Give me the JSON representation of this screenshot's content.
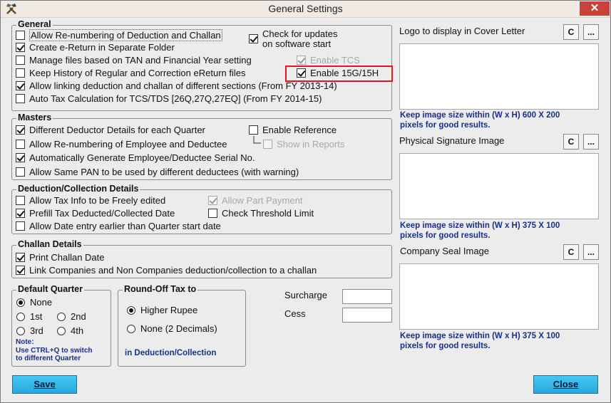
{
  "window": {
    "title": "General Settings",
    "close_glyph": "✕",
    "app_icon": "hammer-pick-icon"
  },
  "general": {
    "title": "General",
    "items": [
      {
        "label": "Allow Re-numbering of Deduction and Challan",
        "checked": false
      },
      {
        "label": "Create e-Return in Separate Folder",
        "checked": true
      },
      {
        "label": "Manage files based on TAN and Financial Year setting",
        "checked": false
      },
      {
        "label": "Keep History of Regular and Correction eReturn files",
        "checked": false
      },
      {
        "label": "Allow linking deduction and challan of different sections (From FY 2013-14)",
        "checked": true
      },
      {
        "label": "Auto Tax Calculation for TCS/TDS [26Q,27Q,27EQ] (From FY 2014-15)",
        "checked": false
      }
    ],
    "check_updates_line1": "Check for updates",
    "check_updates_line2": "on software start",
    "enable_tcs": "Enable TCS",
    "enable_15g": "Enable 15G/15H"
  },
  "masters": {
    "title": "Masters",
    "items": [
      {
        "label": "Different Deductor Details for each Quarter",
        "checked": true
      },
      {
        "label": "Allow Re-numbering of Employee and Deductee",
        "checked": false
      },
      {
        "label": "Automatically Generate Employee/Deductee Serial No.",
        "checked": true
      },
      {
        "label": "Allow Same PAN to be used by different deductees (with warning)",
        "checked": false
      }
    ],
    "enable_reference": "Enable Reference",
    "show_in_reports": "Show in Reports"
  },
  "deduction": {
    "title": "Deduction/Collection Details",
    "items": [
      {
        "label": "Allow Tax Info to be Freely edited",
        "checked": false
      },
      {
        "label": "Prefill Tax Deducted/Collected Date",
        "checked": true
      },
      {
        "label": "Allow Date entry earlier than Quarter start date",
        "checked": false
      }
    ],
    "allow_part_payment": "Allow Part Payment",
    "check_threshold": "Check Threshold Limit"
  },
  "challan": {
    "title": "Challan Details",
    "items": [
      {
        "label": "Print Challan Date",
        "checked": true
      },
      {
        "label": "Link Companies and Non Companies deduction/collection to a challan",
        "checked": true
      }
    ]
  },
  "default_quarter": {
    "title": "Default Quarter",
    "options": [
      "None",
      "1st",
      "2nd",
      "3rd",
      "4th"
    ],
    "selected": "None",
    "note_line1": "Note:",
    "note_line2": "Use CTRL+Q to switch",
    "note_line3": "to different Quarter"
  },
  "roundoff": {
    "title": "Round-Off Tax to",
    "options": [
      "Higher Rupee",
      "None (2 Decimals)"
    ],
    "selected": "Higher Rupee",
    "footer": "in Deduction/Collection"
  },
  "surcharge": {
    "label": "Surcharge",
    "value": ""
  },
  "cess": {
    "label": "Cess",
    "value": ""
  },
  "logo": {
    "label": "Logo to display in Cover Letter",
    "hint1": "Keep image size within (W x H) 600 X 200",
    "hint2": "pixels for good results."
  },
  "signature": {
    "label": "Physical Signature Image",
    "hint1": "Keep image size within (W x H) 375 X 100",
    "hint2": "pixels for good results."
  },
  "seal": {
    "label": "Company Seal Image",
    "hint1": "Keep image size within (W x H) 375 X 100",
    "hint2": "pixels for good results."
  },
  "buttons": {
    "clear": "C",
    "browse": "...",
    "save": "Save",
    "close": "Close"
  }
}
